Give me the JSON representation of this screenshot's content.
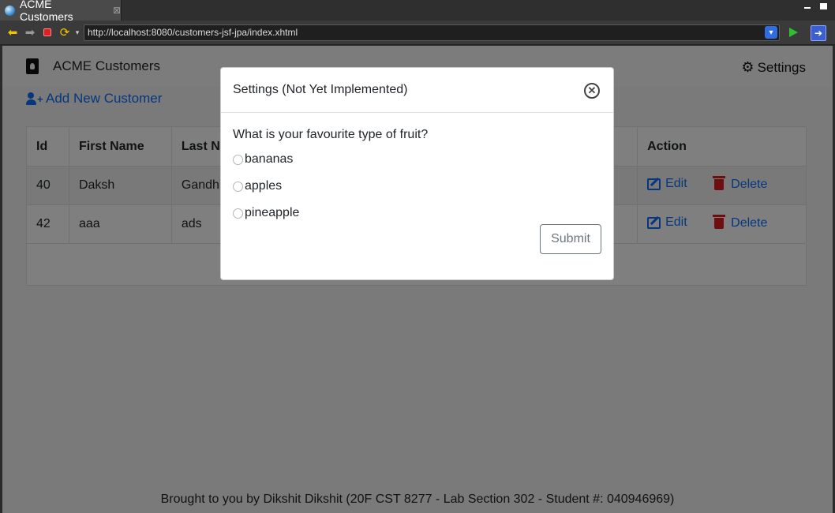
{
  "browser": {
    "tab_title": "ACME Customers",
    "tab_close": "⊠",
    "url": "http://localhost:8080/customers-jsf-jpa/index.xhtml"
  },
  "navbar": {
    "brand": "ACME Customers",
    "settings_label": "Settings"
  },
  "add_customer_label": "Add New Customer",
  "table": {
    "headers": [
      "Id",
      "First Name",
      "Last Name",
      "Action"
    ],
    "rows": [
      {
        "id": "40",
        "first_name": "Daksh",
        "last_name": "Gandhi"
      },
      {
        "id": "42",
        "first_name": "aaa",
        "last_name": "ads"
      }
    ],
    "edit_label": "Edit",
    "delete_label": "Delete"
  },
  "footer_text": "Brought to you by Dikshit Dikshit (20F CST 8277 - Lab Section 302 - Student #: 040946969)",
  "modal": {
    "title": "Settings (Not Yet Implemented)",
    "question": "What is your favourite type of fruit?",
    "options": [
      "bananas",
      "apples",
      "pineapple"
    ],
    "submit_label": "Submit"
  },
  "colors": {
    "link": "#0d6efd",
    "delete": "#dc1c1c"
  }
}
